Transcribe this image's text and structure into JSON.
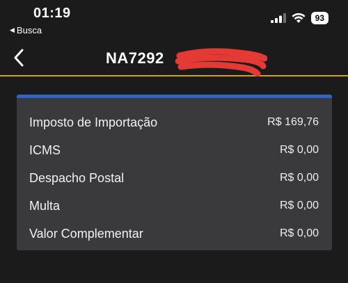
{
  "status_bar": {
    "time": "01:19",
    "back_app_label": "Busca",
    "battery": "93"
  },
  "header": {
    "title": "NA7292"
  },
  "colors": {
    "background": "#1b1b1b",
    "card": "#3a3a3c",
    "accent_bar": "#2f63c6",
    "header_divider": "#d4a21a",
    "redaction": "#e43a36"
  },
  "fees": [
    {
      "label": "Imposto de Importação",
      "amount": "R$ 169,76"
    },
    {
      "label": "ICMS",
      "amount": "R$ 0,00"
    },
    {
      "label": "Despacho Postal",
      "amount": "R$ 0,00"
    },
    {
      "label": "Multa",
      "amount": "R$ 0,00"
    },
    {
      "label": "Valor Complementar",
      "amount": "R$ 0,00"
    }
  ]
}
